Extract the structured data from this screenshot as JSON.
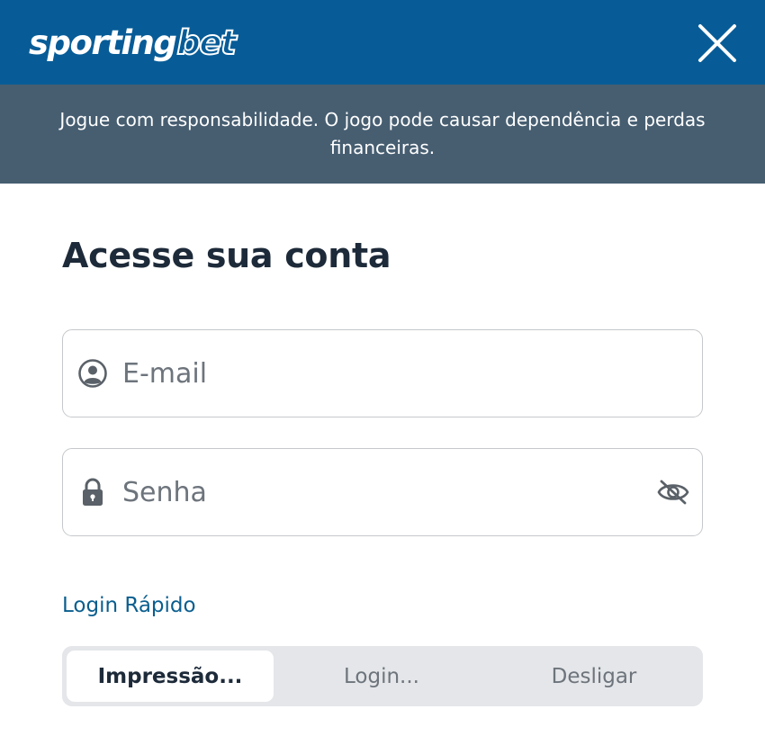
{
  "header": {
    "logo_sporting": "sporting",
    "logo_bet": "bet",
    "close_icon": "close-icon",
    "background": "#075C97"
  },
  "banner": {
    "text": "Jogue com responsabilidade. O jogo pode causar dependência e perdas financeiras.",
    "background": "#475E71"
  },
  "login": {
    "title": "Acesse sua conta",
    "email": {
      "placeholder": "E-mail",
      "value": "",
      "icon": "user-circle-icon"
    },
    "password": {
      "placeholder": "Senha",
      "value": "",
      "icon": "lock-icon",
      "toggle_icon": "eye-off-icon"
    },
    "quick_login_label": "Login Rápido",
    "quick_login_options": [
      "Impressão...",
      "Login...",
      "Desligar"
    ],
    "quick_login_selected": "Impressão..."
  },
  "colors": {
    "title": "#1D2A39",
    "link": "#0A5E8E",
    "placeholder": "#6D747C",
    "field_border": "#C5C8CC",
    "segment_bg": "#E4E6E9"
  }
}
